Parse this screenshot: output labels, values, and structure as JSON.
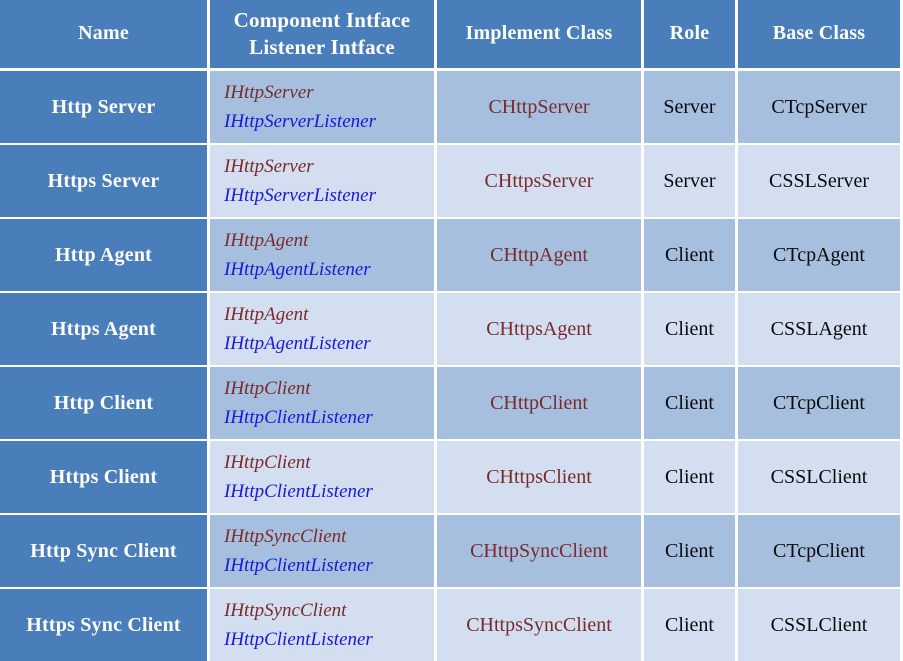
{
  "table": {
    "columns": [
      {
        "key": "name",
        "label": "Name",
        "label_line2": ""
      },
      {
        "key": "interface",
        "label": "Component Intface",
        "label_line2": "Listener Intface"
      },
      {
        "key": "implement_class",
        "label": "Implement Class",
        "label_line2": ""
      },
      {
        "key": "role",
        "label": "Role",
        "label_line2": ""
      },
      {
        "key": "base_class",
        "label": "Base Class",
        "label_line2": ""
      }
    ],
    "colors": {
      "header_background": "#4a7ebb",
      "header_text": "#ffffff",
      "name_column_background": "#4a7ebb",
      "row_background_odd": "#a6bfdf",
      "row_background_even": "#d3dff0",
      "component_interface_text": "#7a2a2a",
      "listener_interface_text": "#1818d8",
      "implement_class_text": "#7a2a2a",
      "body_text": "#0a0a0a",
      "grid_line": "#ffffff"
    },
    "rows": [
      {
        "name": "Http Server",
        "component_interface": "IHttpServer",
        "listener_interface": "IHttpServerListener",
        "implement_class": "CHttpServer",
        "role": "Server",
        "base_class": "CTcpServer"
      },
      {
        "name": "Https Server",
        "component_interface": "IHttpServer",
        "listener_interface": "IHttpServerListener",
        "implement_class": "CHttpsServer",
        "role": "Server",
        "base_class": "CSSLServer"
      },
      {
        "name": "Http Agent",
        "component_interface": "IHttpAgent",
        "listener_interface": "IHttpAgentListener",
        "implement_class": "CHttpAgent",
        "role": "Client",
        "base_class": "CTcpAgent"
      },
      {
        "name": "Https Agent",
        "component_interface": "IHttpAgent",
        "listener_interface": "IHttpAgentListener",
        "implement_class": "CHttpsAgent",
        "role": "Client",
        "base_class": "CSSLAgent"
      },
      {
        "name": "Http Client",
        "component_interface": "IHttpClient",
        "listener_interface": "IHttpClientListener",
        "implement_class": "CHttpClient",
        "role": "Client",
        "base_class": "CTcpClient"
      },
      {
        "name": "Https Client",
        "component_interface": "IHttpClient",
        "listener_interface": "IHttpClientListener",
        "implement_class": "CHttpsClient",
        "role": "Client",
        "base_class": "CSSLClient"
      },
      {
        "name": "Http Sync Client",
        "component_interface": "IHttpSyncClient",
        "listener_interface": "IHttpClientListener",
        "implement_class": "CHttpSyncClient",
        "role": "Client",
        "base_class": "CTcpClient"
      },
      {
        "name": "Https Sync Client",
        "component_interface": "IHttpSyncClient",
        "listener_interface": "IHttpClientListener",
        "implement_class": "CHttpsSyncClient",
        "role": "Client",
        "base_class": "CSSLClient"
      }
    ]
  }
}
